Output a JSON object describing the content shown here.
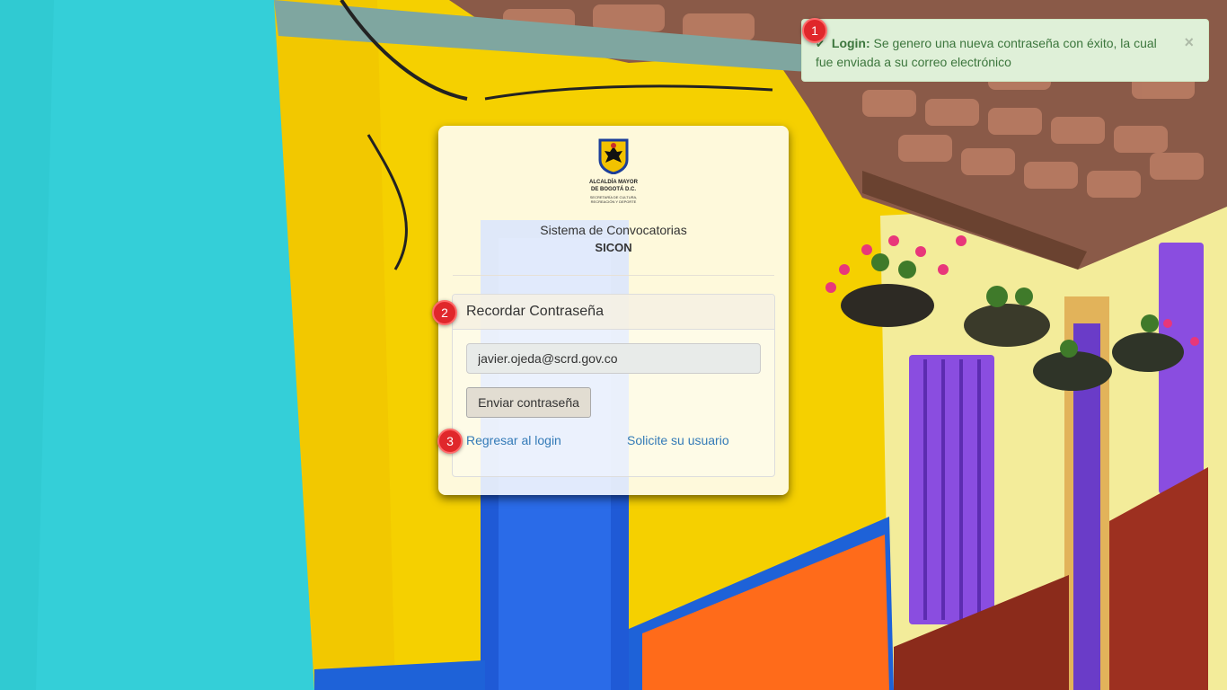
{
  "notification": {
    "title": "Login:",
    "message": "Se genero una nueva contraseña con éxito, la cual fue enviada a su correo electrónico",
    "close_label": "×"
  },
  "logo": {
    "line1": "ALCALDÍA MAYOR",
    "line2": "DE BOGOTÁ D.C.",
    "line3": "SECRETARÍA DE CULTURA,",
    "line4": "RECREACIÓN Y DEPORTE"
  },
  "system": {
    "title": "Sistema de Convocatorias",
    "name": "SICON"
  },
  "recover_panel": {
    "heading": "Recordar Contraseña",
    "email_value": "javier.ojeda@scrd.gov.co",
    "send_label": "Enviar contraseña",
    "back_link": "Regresar al login",
    "request_user_link": "Solicite su usuario"
  },
  "step_badges": [
    "1",
    "2",
    "3"
  ],
  "colors": {
    "success_bg": "#dff0d8",
    "success_text": "#3c763d",
    "link": "#337ab7",
    "badge": "#e0272b"
  }
}
